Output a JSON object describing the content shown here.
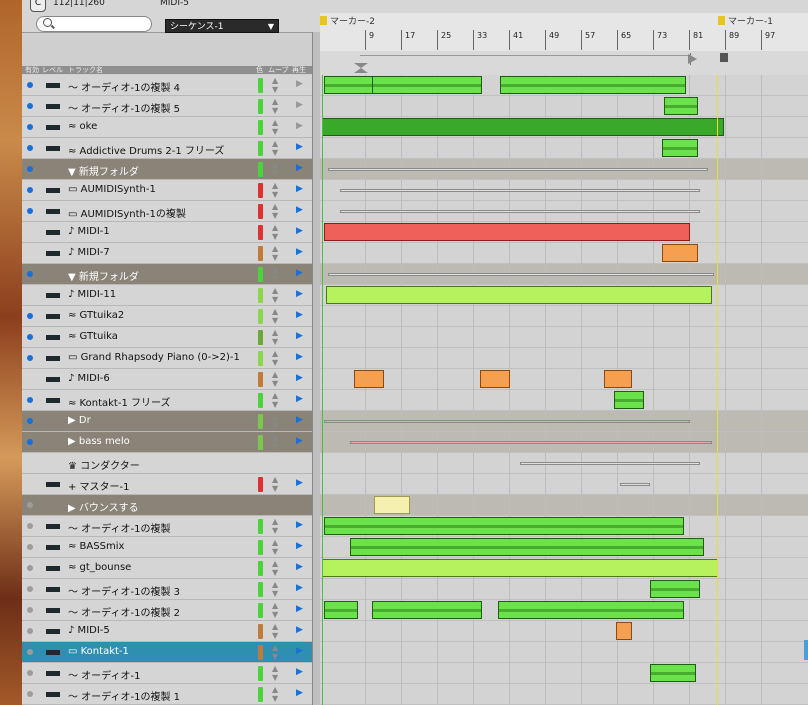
{
  "topbar": {
    "c_button": "C",
    "timecode": "112|11|260",
    "sequence_name": "MIDI-5",
    "sequence_select": "シーケンス-1"
  },
  "header": {
    "col_enable": "有効",
    "col_level": "レベル",
    "col_track": "トラック名",
    "col_color": "色",
    "col_move": "ムーブ",
    "col_play": "再生"
  },
  "ruler": {
    "marker_left": "マーカー-2",
    "marker_right": "マーカー-1",
    "ticks": [
      "9",
      "17",
      "25",
      "33",
      "41",
      "49",
      "57",
      "65",
      "73",
      "81",
      "89",
      "97"
    ]
  },
  "tracks": [
    {
      "name": "〜 オーディオ-1の複製 4",
      "folder": false,
      "dot": "on",
      "color": "#4bd43a",
      "play": "grey"
    },
    {
      "name": "〜 オーディオ-1の複製 5",
      "folder": false,
      "dot": "on",
      "color": "#4bd43a",
      "play": "grey"
    },
    {
      "name": "≈ oke",
      "folder": false,
      "dot": "on",
      "color": "#4bd43a",
      "play": "grey"
    },
    {
      "name": "≈ Addictive Drums 2-1 フリーズ",
      "folder": false,
      "dot": "on",
      "color": "#4bd43a",
      "play": "on"
    },
    {
      "name": "▼ 新規フォルダ",
      "folder": true,
      "dot": "on",
      "color": "#4bd43a",
      "play": "on"
    },
    {
      "name": "▭ AUMIDISynth-1",
      "folder": false,
      "dot": "on",
      "color": "#e03030",
      "play": "on"
    },
    {
      "name": "▭ AUMIDISynth-1の複製",
      "folder": false,
      "dot": "on",
      "color": "#e03030",
      "play": "on"
    },
    {
      "name": "♪ MIDI-1",
      "folder": false,
      "dot": "none",
      "color": "#e03030",
      "play": "on"
    },
    {
      "name": "♪ MIDI-7",
      "folder": false,
      "dot": "none",
      "color": "#c07a3a",
      "play": "on"
    },
    {
      "name": "▼ 新規フォルダ",
      "folder": true,
      "dot": "on",
      "color": "#4bd43a",
      "play": "on"
    },
    {
      "name": "♪ MIDI-11",
      "folder": false,
      "dot": "none",
      "color": "#8ad84a",
      "play": "on"
    },
    {
      "name": "≈ GTtuika2",
      "folder": false,
      "dot": "on",
      "color": "#8ad84a",
      "play": "on"
    },
    {
      "name": "≈ GTtuika",
      "folder": false,
      "dot": "on",
      "color": "#6aa83a",
      "play": "on"
    },
    {
      "name": "▭ Grand Rhapsody Piano (0->2)-1",
      "folder": false,
      "dot": "on",
      "color": "#8ad84a",
      "play": "on"
    },
    {
      "name": "♪ MIDI-6",
      "folder": false,
      "dot": "none",
      "color": "#c07a3a",
      "play": "on"
    },
    {
      "name": "≈ Kontakt-1 フリーズ",
      "folder": false,
      "dot": "on",
      "color": "#4bd43a",
      "play": "on"
    },
    {
      "name": "▶ Dr",
      "folder": true,
      "dot": "on",
      "color": "#7ac84a",
      "play": "on"
    },
    {
      "name": "▶ bass melo",
      "folder": true,
      "dot": "on",
      "color": "#7ac84a",
      "play": "on"
    },
    {
      "name": "♛ コンダクター",
      "folder": false,
      "dot": "none",
      "color": "",
      "play": "none"
    },
    {
      "name": "+ マスター-1",
      "folder": false,
      "dot": "none",
      "color": "#e03030",
      "play": "on"
    },
    {
      "name": "▶ バウンスする",
      "folder": true,
      "dot": "off",
      "color": "",
      "play": "none"
    },
    {
      "name": "〜 オーディオ-1の複製",
      "folder": false,
      "dot": "off",
      "color": "#4bd43a",
      "play": "on"
    },
    {
      "name": "≈ BASSmix",
      "folder": false,
      "dot": "off",
      "color": "#4bd43a",
      "play": "on"
    },
    {
      "name": "≈ gt_bounse",
      "folder": false,
      "dot": "off",
      "color": "#4bd43a",
      "play": "on"
    },
    {
      "name": "〜 オーディオ-1の複製 3",
      "folder": false,
      "dot": "off",
      "color": "#4bd43a",
      "play": "on"
    },
    {
      "name": "〜 オーディオ-1の複製 2",
      "folder": false,
      "dot": "off",
      "color": "#4bd43a",
      "play": "on"
    },
    {
      "name": "♪ MIDI-5",
      "folder": false,
      "dot": "off",
      "color": "#c07a3a",
      "play": "on"
    },
    {
      "name": "▭ Kontakt-1",
      "folder": false,
      "dot": "off",
      "color": "#c07a3a",
      "play": "on",
      "selected": true
    },
    {
      "name": "〜 オーディオ-1",
      "folder": false,
      "dot": "off",
      "color": "#4bd43a",
      "play": "on"
    },
    {
      "name": "〜 オーディオ-1の複製 1",
      "folder": false,
      "dot": "off",
      "color": "#4bd43a",
      "play": "on"
    }
  ]
}
